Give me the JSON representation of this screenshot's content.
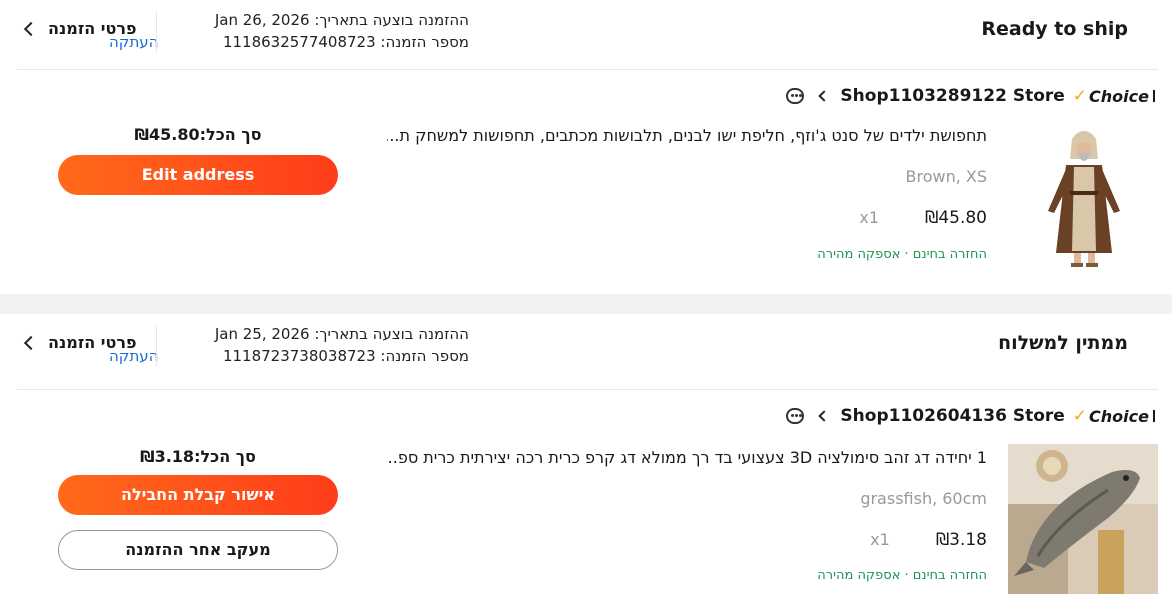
{
  "orders": [
    {
      "status": "Ready to ship",
      "date_label": "ההזמנה בוצעה בתאריך:",
      "date": "Jan 26, 2026",
      "order_no_label": "מספר הזמנה:",
      "order_no": "1118632577408723",
      "copy_label": "העתקה",
      "details_label": "פרטי הזמנה",
      "choice_label": "Choice",
      "store": "Shop1103289122 Store",
      "item_title": "תחפושת ילדים של סנט ג'וזף, חליפת ישו לבנים, תלבושות מכתבים, תחפושות למשחק ת...",
      "variant": "Brown, XS",
      "price": "₪45.80",
      "qty": "x1",
      "perks": "החזרה בחינם · אספקה מהירה",
      "total": "סך הכל:₪45.80",
      "buttons": [
        "Edit address"
      ],
      "image_icon": "costume-photo"
    },
    {
      "status": "ממתין למשלוח",
      "date_label": "ההזמנה בוצעה בתאריך:",
      "date": "Jan 25, 2026",
      "order_no_label": "מספר הזמנה:",
      "order_no": "1118723738038723",
      "copy_label": "העתקה",
      "details_label": "פרטי הזמנה",
      "choice_label": "Choice",
      "store": "Shop1102604136 Store",
      "item_title": "1 יחידה דג זהב סימולציה 3D צעצועי בד רך ממולא דג קרפ כרית רכה יצירתית כרית ספ...",
      "variant": "grassfish, 60cm",
      "price": "₪3.18",
      "qty": "x1",
      "perks": "החזרה בחינם · אספקה מהירה",
      "total": "סך הכל:₪3.18",
      "buttons": [
        "אישור קבלת החבילה",
        "מעקב אחר ההזמנה"
      ],
      "image_icon": "fish-pillow-photo"
    }
  ],
  "colors": {
    "accent": "#ff4f1a",
    "link": "#1a6bd6",
    "perk": "#1d9355",
    "choice_check": "#f5a623"
  }
}
